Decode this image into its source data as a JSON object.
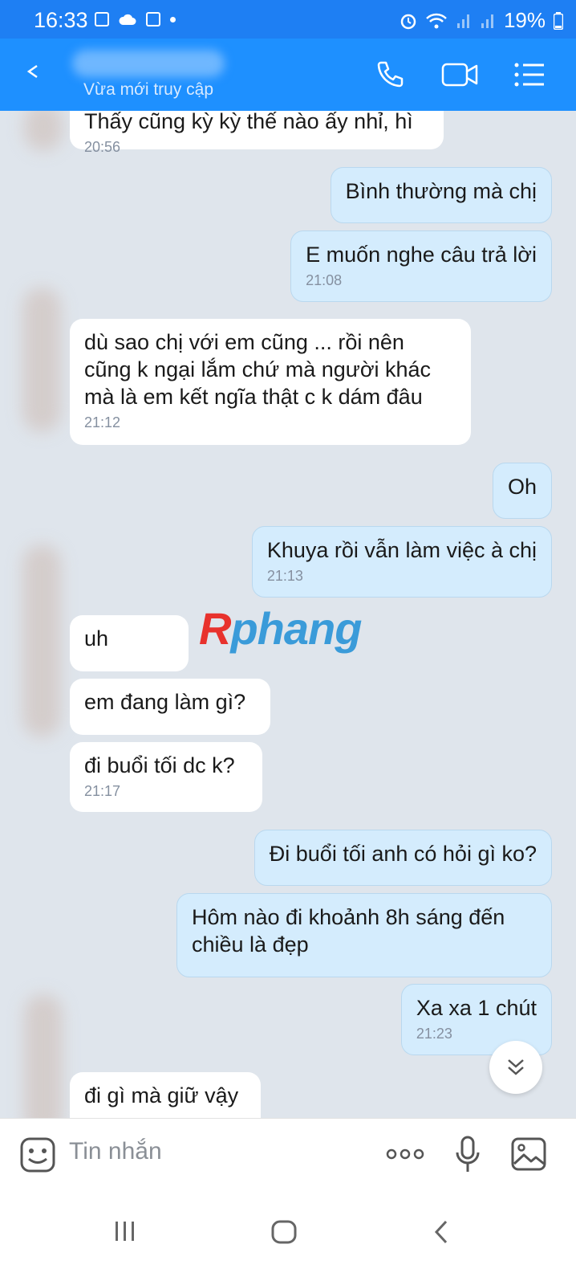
{
  "status_bar": {
    "time": "16:33",
    "battery": "19%"
  },
  "header": {
    "subtitle": "Vừa mới truy cập"
  },
  "messages": [
    {
      "dir": "in",
      "text": "Thấy cũng kỳ kỳ thế nào ấy nhỉ, hì",
      "time": "20:56"
    },
    {
      "dir": "out",
      "text": "Bình thường mà chị",
      "time": ""
    },
    {
      "dir": "out",
      "text": "E muốn nghe câu trả lời",
      "time": "21:08"
    },
    {
      "dir": "in",
      "text": "dù sao chị với em cũng ... rồi nên cũng k ngại lắm chứ mà người khác mà là em kết ngĩa thật c k dám đâu",
      "time": "21:12"
    },
    {
      "dir": "out",
      "text": "Oh",
      "time": ""
    },
    {
      "dir": "out",
      "text": "Khuya rồi vẫn làm việc à chị",
      "time": "21:13"
    },
    {
      "dir": "in",
      "text": "uh",
      "time": ""
    },
    {
      "dir": "in",
      "text": "em đang làm gì?",
      "time": ""
    },
    {
      "dir": "in",
      "text": "đi buổi tối dc k?",
      "time": "21:17"
    },
    {
      "dir": "out",
      "text": "Đi buổi tối anh có hỏi gì ko?",
      "time": ""
    },
    {
      "dir": "out",
      "text": "Hôm nào đi khoảnh 8h sáng đến chiều là đẹp",
      "time": ""
    },
    {
      "dir": "out",
      "text": "Xa xa 1 chút",
      "time": "21:23"
    },
    {
      "dir": "in",
      "text": "đi gì mà giữ vậy",
      "time": ""
    }
  ],
  "watermark": {
    "first": "R",
    "rest": "phang"
  },
  "input": {
    "placeholder": "Tin nhắn"
  },
  "colors": {
    "header": "#1e90ff",
    "status_bar": "#1e7ff3",
    "chat_bg": "#dfe5ec",
    "outgoing_bubble": "#d4ecfd",
    "incoming_bubble": "#ffffff"
  },
  "icons": [
    "back-icon",
    "phone-icon",
    "video-call-icon",
    "menu-list-icon",
    "scroll-down-icon",
    "sticker-icon",
    "more-icon",
    "microphone-icon",
    "image-icon",
    "recent-apps-icon",
    "home-icon",
    "back-nav-icon"
  ]
}
